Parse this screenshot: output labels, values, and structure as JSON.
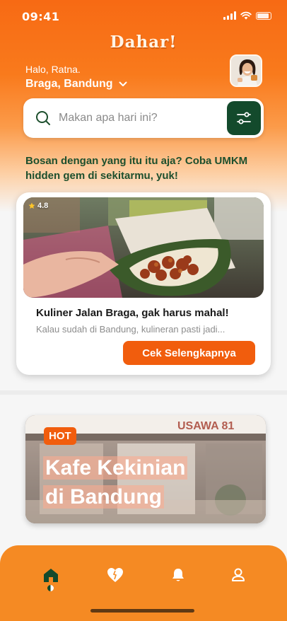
{
  "status": {
    "time": "09:41"
  },
  "app": {
    "name": "Dahar!"
  },
  "header": {
    "greeting": "Halo, Ratna.",
    "location": "Braga, Bandung"
  },
  "search": {
    "placeholder": "Makan apa hari ini?",
    "value": ""
  },
  "promo": {
    "text": "Bosan dengan yang itu itu aja? Coba UMKM hidden gem di sekitarmu, yuk!"
  },
  "featured_card": {
    "rating": "4.8",
    "title": "Kuliner Jalan Braga, gak harus mahal!",
    "description": "Kalau sudah di Bandung, kulineran pasti jadi...",
    "button_label": "Cek Selengkapnya"
  },
  "hot_card": {
    "badge": "HOT",
    "title_line1": "Kafe Kekinian",
    "title_line2": "di Bandung"
  },
  "nav": {
    "items": [
      {
        "icon": "home-icon",
        "active": true
      },
      {
        "icon": "heart-icon",
        "active": false
      },
      {
        "icon": "bell-icon",
        "active": false
      },
      {
        "icon": "profile-icon",
        "active": false
      }
    ]
  },
  "colors": {
    "primary": "#f15d0d",
    "dark_green": "#134a2c",
    "nav_bg": "#f58a23"
  }
}
